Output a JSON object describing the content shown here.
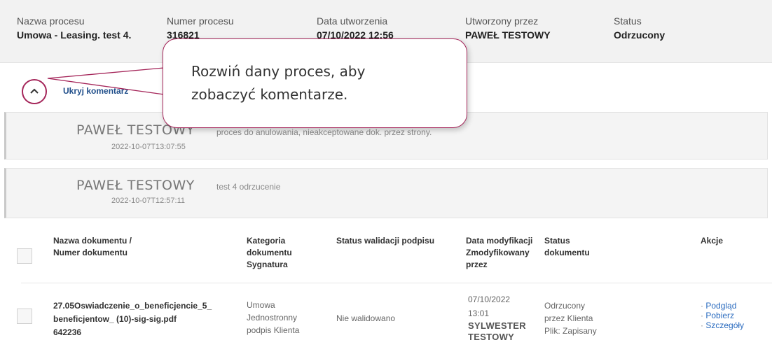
{
  "summary": {
    "process_name_label": "Nazwa procesu",
    "process_name_value": "Umowa - Leasing. test 4.",
    "process_number_label": "Numer procesu",
    "process_number_value": "316821",
    "created_date_label": "Data utworzenia",
    "created_date_value": "07/10/2022 12:56",
    "created_by_label": "Utworzony przez",
    "created_by_value": "PAWEŁ TESTOWY",
    "status_label": "Status",
    "status_value": "Odrzucony"
  },
  "comments_toggle": {
    "icon": "chevron-up-icon",
    "label": "Ukryj komentarz"
  },
  "comments": [
    {
      "author": "PAWEŁ TESTOWY",
      "date": "2022-10-07T13:07:55",
      "text": "proces do anulowania, nieakceptowane dok. przez strony."
    },
    {
      "author": "PAWEŁ TESTOWY",
      "date": "2022-10-07T12:57:11",
      "text": "test 4 odrzucenie"
    }
  ],
  "table": {
    "headers": {
      "name_line1": "Nazwa dokumentu /",
      "name_line2": "Numer dokumentu",
      "category_line1": "Kategoria",
      "category_line2": "dokumentu",
      "category_line3": "Sygnatura",
      "signature_status": "Status walidacji podpisu",
      "modified_line1": "Data modyfikacji",
      "modified_line2": "Zmodyfikowany",
      "modified_line3": "przez",
      "doc_status_line1": "Status",
      "doc_status_line2": "dokumentu",
      "actions": "Akcje"
    },
    "rows": [
      {
        "name_line1": "27.05Oswiadczenie_o_beneficjencie_5_",
        "name_line2": "beneficjentow_ (10)-sig-sig.pdf",
        "doc_number": "642236",
        "category_line1": "Umowa",
        "category_line2": "Jednostronny",
        "category_line3": "podpis Klienta",
        "signature_status": "Nie walidowano",
        "modified_date": "07/10/2022",
        "modified_time": "13:01",
        "modified_by_line1": "SYLWESTER",
        "modified_by_line2": "TESTOWY",
        "status_line1": "Odrzucony",
        "status_line2": "przez Klienta",
        "status_line3": "Plik: Zapisany",
        "actions": [
          "Podgląd",
          "Pobierz",
          "Szczegóły"
        ]
      }
    ]
  },
  "callout": {
    "line1": "Rozwiń dany proces, aby",
    "line2": "zobaczyć komentarze."
  },
  "colors": {
    "accent": "#a5265a",
    "link": "#2a6bbf",
    "toggle_link": "#1f4e8a"
  }
}
